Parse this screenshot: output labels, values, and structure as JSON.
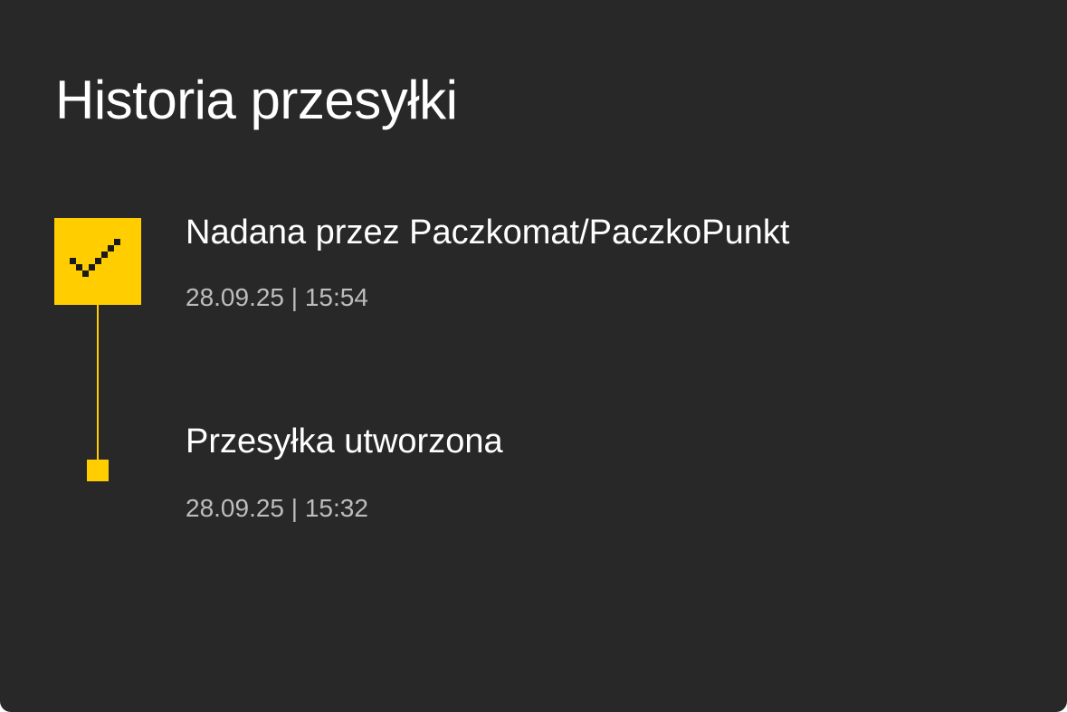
{
  "header": {
    "title": "Historia przesyłki"
  },
  "events": [
    {
      "label": "Nadana przez Paczkomat/PaczkoPunkt",
      "datetime": "28.09.25 | 15:54",
      "status_icon": "check-icon",
      "completed": true
    },
    {
      "label": "Przesyłka utworzona",
      "datetime": "28.09.25 | 15:32",
      "status_icon": "square-dot-icon",
      "completed": true
    }
  ],
  "colors": {
    "background": "#282828",
    "accent": "#ffcd00",
    "text_primary": "#ffffff",
    "text_secondary": "#bdbdbd"
  }
}
